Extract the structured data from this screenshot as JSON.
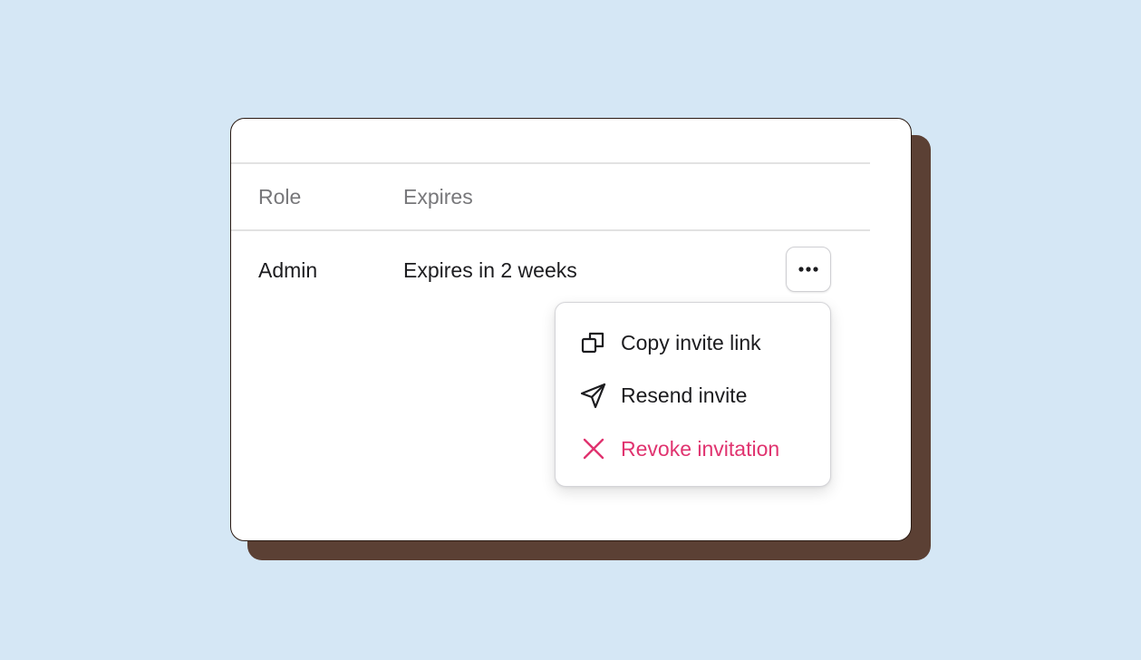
{
  "table": {
    "headers": {
      "role": "Role",
      "expires": "Expires"
    },
    "rows": [
      {
        "role": "Admin",
        "expires": "Expires in 2 weeks"
      }
    ]
  },
  "actions_button": {
    "icon": "more-horizontal-icon"
  },
  "menu": {
    "items": [
      {
        "label": "Copy invite link",
        "icon": "copy-icon"
      },
      {
        "label": "Resend invite",
        "icon": "send-icon"
      },
      {
        "label": "Revoke invitation",
        "icon": "close-icon",
        "color": "#e0336f"
      }
    ]
  },
  "colors": {
    "background": "#d5e7f5",
    "card_shadow": "#5b4034",
    "danger": "#e0336f"
  }
}
